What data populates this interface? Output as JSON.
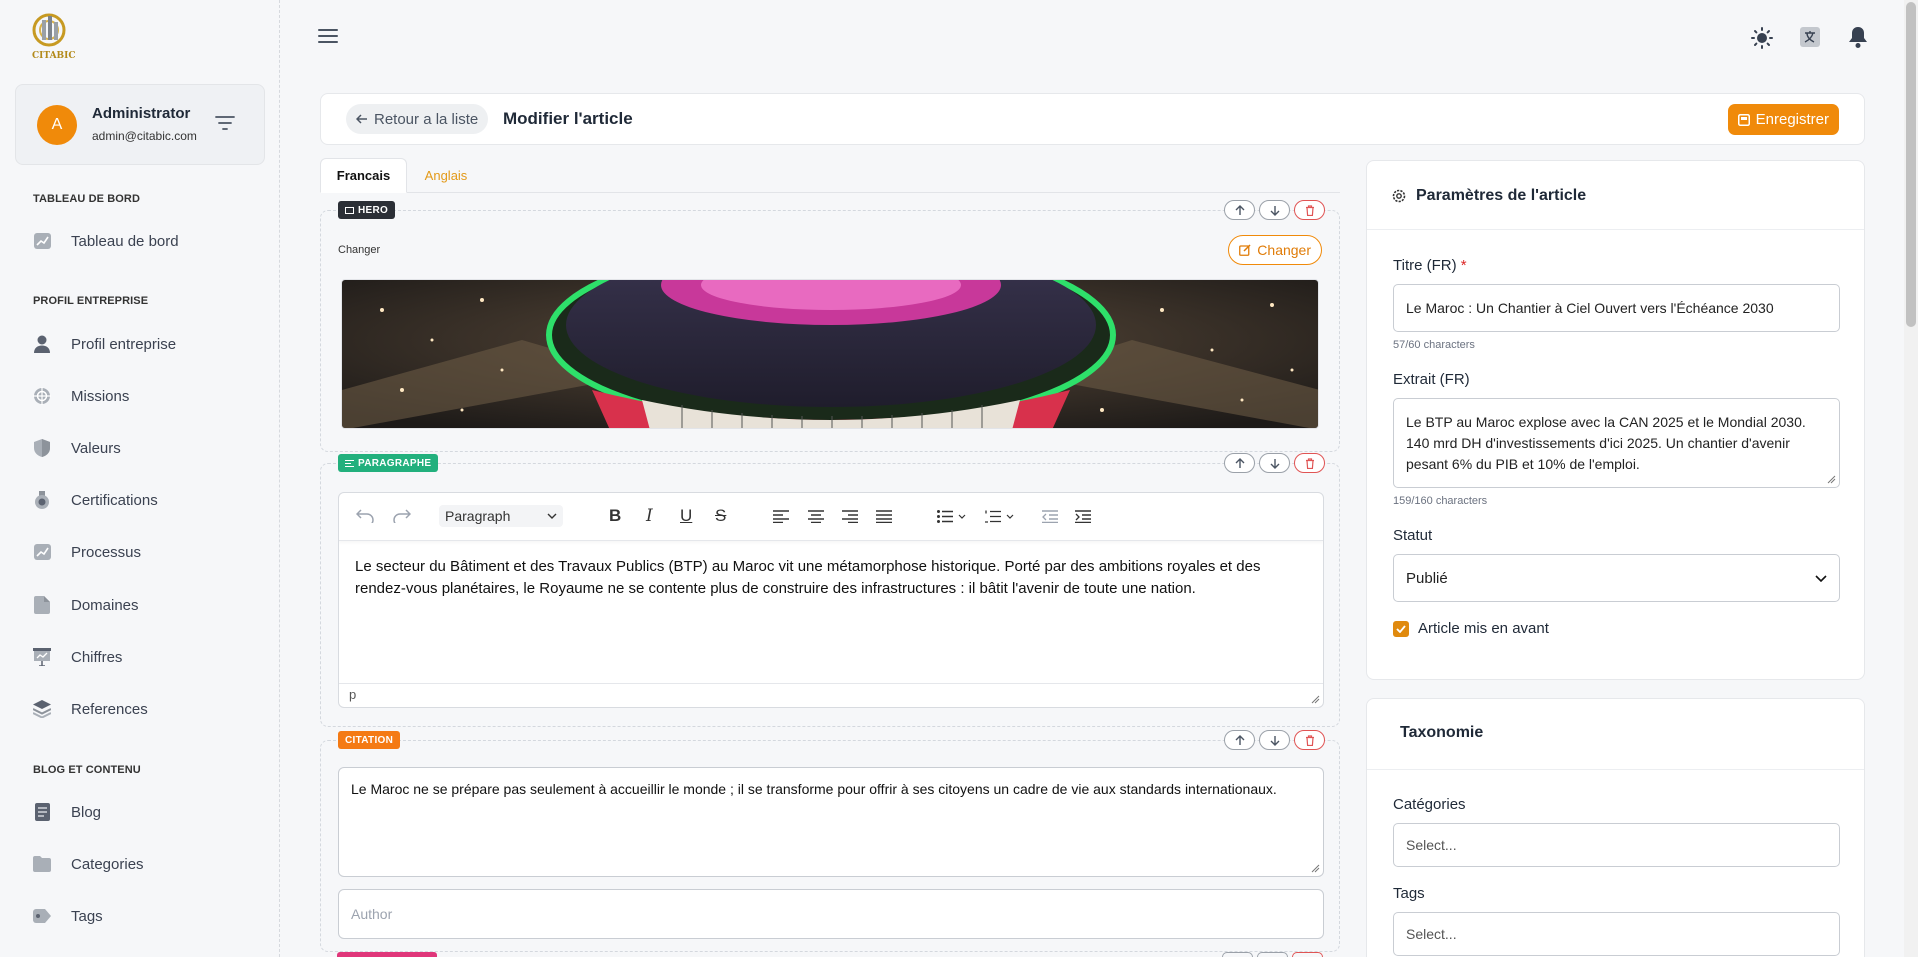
{
  "brand": {
    "logo_text": "CITABIC"
  },
  "user": {
    "initial": "A",
    "name": "Administrator",
    "email": "admin@citabic.com"
  },
  "sidebar": {
    "sections": [
      {
        "title": "TABLEAU DE BORD",
        "items": [
          {
            "label": "Tableau de bord",
            "icon": "chart-icon"
          }
        ]
      },
      {
        "title": "PROFIL ENTREPRISE",
        "items": [
          {
            "label": "Profil entreprise",
            "icon": "user-icon"
          },
          {
            "label": "Missions",
            "icon": "target-icon"
          },
          {
            "label": "Valeurs",
            "icon": "shield-icon"
          },
          {
            "label": "Certifications",
            "icon": "medal-icon"
          },
          {
            "label": "Processus",
            "icon": "chart-icon"
          },
          {
            "label": "Domaines",
            "icon": "pie-icon"
          },
          {
            "label": "Chiffres",
            "icon": "presentation-icon"
          },
          {
            "label": "References",
            "icon": "layers-icon"
          }
        ]
      },
      {
        "title": "BLOG ET CONTENU",
        "items": [
          {
            "label": "Blog",
            "icon": "document-icon"
          },
          {
            "label": "Categories",
            "icon": "folder-icon"
          },
          {
            "label": "Tags",
            "icon": "tag-icon"
          }
        ]
      }
    ]
  },
  "header": {
    "back_label": "Retour a la liste",
    "title": "Modifier l'article",
    "save_label": "Enregistrer"
  },
  "tabs": [
    {
      "label": "Francais",
      "active": true
    },
    {
      "label": "Anglais",
      "active": false
    }
  ],
  "blocks": {
    "hero": {
      "badge": "HERO",
      "label": "Changer",
      "change_button": "Changer",
      "badge_color": "#2b2f36"
    },
    "paragraph": {
      "badge": "PARAGRAPHE",
      "badge_color": "#22b07d",
      "format_select": "Paragraph",
      "text": "Le secteur du Bâtiment et des Travaux Publics (BTP) au Maroc vit une métamorphose historique. Porté par des ambitions royales et des rendez-vous planétaires, le Royaume ne se contente plus de construire des infrastructures : il bâtit l'avenir de toute une nation.",
      "status_path": "p"
    },
    "citation": {
      "badge": "CITATION",
      "badge_color": "#f47a14",
      "quote": "Le Maroc ne se prépare pas seulement à accueillir le monde ; il se transforme pour offrir à ses citoyens un cadre de vie aux standards internationaux.",
      "author_placeholder": "Author"
    }
  },
  "settings": {
    "title": "Paramètres de l'article",
    "title_label": "Titre (FR)",
    "required_mark": "*",
    "title_value": "Le Maroc : Un Chantier à Ciel Ouvert vers l'Échéance 2030",
    "title_counter": "57/60 characters",
    "excerpt_label": "Extrait (FR)",
    "excerpt_value": "Le BTP au Maroc explose avec la CAN 2025 et le Mondial 2030. 140 mrd DH d'investissements d'ici 2025. Un chantier d'avenir pesant 6% du PIB et 10% de l'emploi.",
    "excerpt_counter": "159/160 characters",
    "status_label": "Statut",
    "status_value": "Publié",
    "featured_label": "Article mis en avant",
    "featured_checked": true
  },
  "taxonomy": {
    "title": "Taxonomie",
    "categories_label": "Catégories",
    "categories_placeholder": "Select...",
    "tags_label": "Tags",
    "tags_placeholder": "Select..."
  },
  "colors": {
    "accent": "#f08a0a",
    "link": "#e39a19",
    "danger": "#e05454"
  }
}
